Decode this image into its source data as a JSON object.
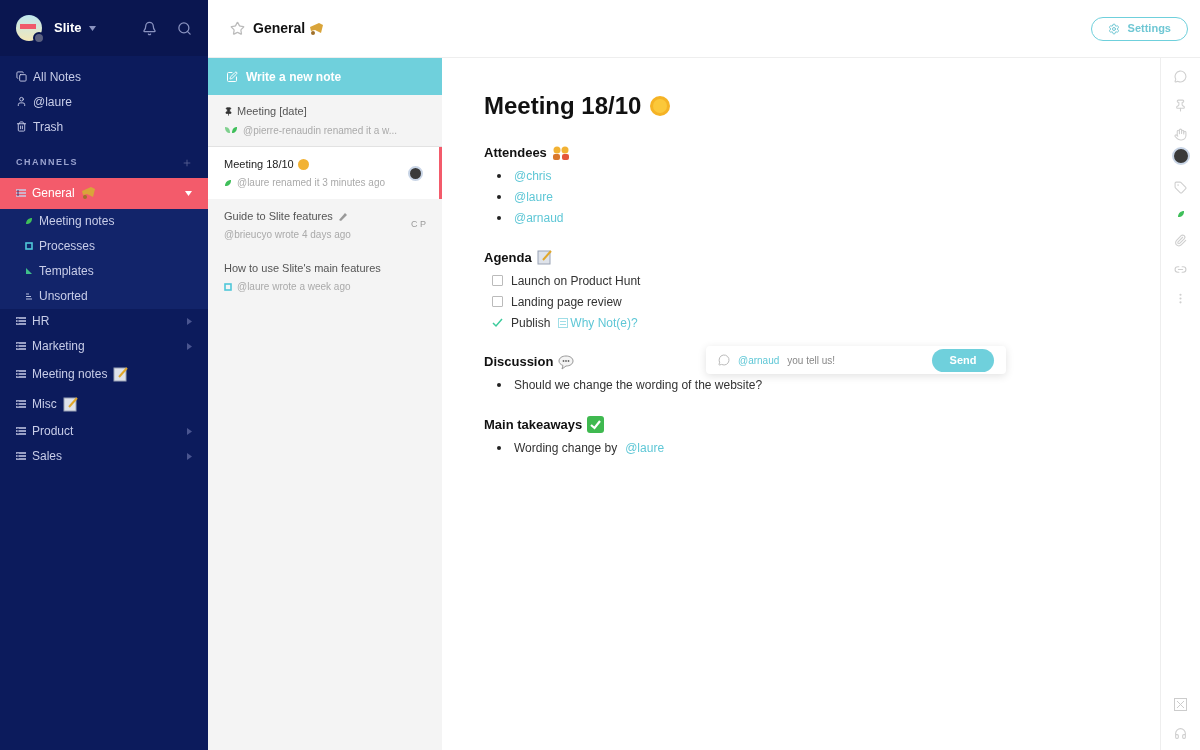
{
  "sidebar": {
    "workspace": "Slite",
    "nav": [
      {
        "kind": "all",
        "label": "All Notes"
      },
      {
        "kind": "user",
        "label": "@laure"
      },
      {
        "kind": "trash",
        "label": "Trash"
      }
    ],
    "channels_heading": "CHANNELS",
    "channels": [
      {
        "name": "General",
        "kind": "group",
        "selected": true,
        "expanded": true,
        "children": [
          {
            "name": "Meeting notes",
            "kind": "leaf"
          },
          {
            "name": "Processes",
            "kind": "square"
          },
          {
            "name": "Templates",
            "kind": "triangle"
          },
          {
            "name": "Unsorted",
            "kind": "lines"
          }
        ]
      },
      {
        "name": "HR",
        "kind": "group",
        "selected": false,
        "expanded": false
      },
      {
        "name": "Marketing",
        "kind": "group",
        "selected": false,
        "expanded": false
      },
      {
        "name": "Meeting notes",
        "kind": "note",
        "selected": false,
        "expanded": false
      },
      {
        "name": "Misc",
        "kind": "note",
        "selected": false,
        "expanded": false
      },
      {
        "name": "Product",
        "kind": "group",
        "selected": false,
        "expanded": false
      },
      {
        "name": "Sales",
        "kind": "group",
        "selected": false,
        "expanded": false
      }
    ]
  },
  "header": {
    "title": "General",
    "settings": "Settings"
  },
  "notes": {
    "new_note": "Write a new note",
    "items": [
      {
        "title": "Meeting [date]",
        "meta": "@pierre-renaudin renamed it a w...",
        "selected": false,
        "pinned": true,
        "kind": "leaves"
      },
      {
        "title": "Meeting 18/10",
        "meta": "@laure renamed it 3 minutes ago",
        "selected": true,
        "pinned": false,
        "kind": "leaf"
      },
      {
        "title": "Guide to Slite features",
        "meta": "@brieucyo wrote 4 days ago",
        "selected": false,
        "pinned": false,
        "kind": "none",
        "initials": "C P"
      },
      {
        "title": "How to use Slite's main features",
        "meta": "@laure wrote a week ago",
        "selected": false,
        "pinned": false,
        "kind": "square"
      }
    ]
  },
  "document": {
    "title": "Meeting 18/10",
    "sections": [
      {
        "heading": "Attendees",
        "items": [
          {
            "kind": "bullet",
            "mention": "@chris"
          },
          {
            "kind": "bullet",
            "mention": "@laure"
          },
          {
            "kind": "bullet",
            "mention": "@arnaud"
          }
        ]
      },
      {
        "heading": "Agenda",
        "items": [
          {
            "kind": "check",
            "text": "Launch on Product Hunt",
            "checked": false
          },
          {
            "kind": "check",
            "text": "Landing page review",
            "checked": false
          },
          {
            "kind": "check",
            "text": "Publish",
            "link": "Why Not(e)?",
            "checked": true
          }
        ]
      },
      {
        "heading": "Discussion",
        "items": [
          {
            "kind": "bullet",
            "text": "Should we change the wording of the website?"
          }
        ]
      },
      {
        "heading": "Main takeaways",
        "items": [
          {
            "kind": "bullet",
            "text": "Wording change by",
            "mention": "@laure"
          }
        ]
      }
    ]
  },
  "comment": {
    "mention": "@arnaud",
    "value": "you tell us!",
    "button": "Send"
  }
}
